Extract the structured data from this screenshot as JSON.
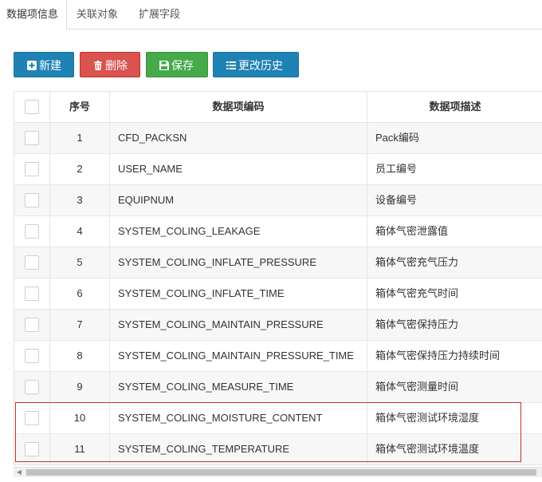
{
  "tabs": [
    {
      "label": "数据项信息",
      "active": true
    },
    {
      "label": "关联对象",
      "active": false
    },
    {
      "label": "扩展字段",
      "active": false
    }
  ],
  "toolbar": {
    "new_label": "新建",
    "delete_label": "删除",
    "save_label": "保存",
    "history_label": "更改历史"
  },
  "table": {
    "headers": {
      "index": "序号",
      "code": "数据项编码",
      "description": "数据项描述"
    },
    "rows": [
      {
        "index": "1",
        "code": "CFD_PACKSN",
        "description": "Pack编码"
      },
      {
        "index": "2",
        "code": "USER_NAME",
        "description": "员工编号"
      },
      {
        "index": "3",
        "code": "EQUIPNUM",
        "description": "设备编号"
      },
      {
        "index": "4",
        "code": "SYSTEM_COLING_LEAKAGE",
        "description": "箱体气密泄露值"
      },
      {
        "index": "5",
        "code": "SYSTEM_COLING_INFLATE_PRESSURE",
        "description": "箱体气密充气压力"
      },
      {
        "index": "6",
        "code": "SYSTEM_COLING_INFLATE_TIME",
        "description": "箱体气密充气时间"
      },
      {
        "index": "7",
        "code": "SYSTEM_COLING_MAINTAIN_PRESSURE",
        "description": "箱体气密保持压力"
      },
      {
        "index": "8",
        "code": "SYSTEM_COLING_MAINTAIN_PRESSURE_TIME",
        "description": "箱体气密保持压力持续时间"
      },
      {
        "index": "9",
        "code": "SYSTEM_COLING_MEASURE_TIME",
        "description": "箱体气密测量时间"
      },
      {
        "index": "10",
        "code": "SYSTEM_COLING_MOISTURE_CONTENT",
        "description": "箱体气密测试环境湿度"
      },
      {
        "index": "11",
        "code": "SYSTEM_COLING_TEMPERATURE",
        "description": "箱体气密测试环境温度"
      }
    ]
  },
  "colors": {
    "primary": "#1f82b4",
    "danger": "#d9534f",
    "success": "#46a94a",
    "highlight_border": "#c9302c"
  },
  "icons": {
    "new": "plus-square-icon",
    "delete": "trash-icon",
    "save": "floppy-disk-icon",
    "history": "list-icon",
    "scroll_left": "chevron-left-icon"
  }
}
